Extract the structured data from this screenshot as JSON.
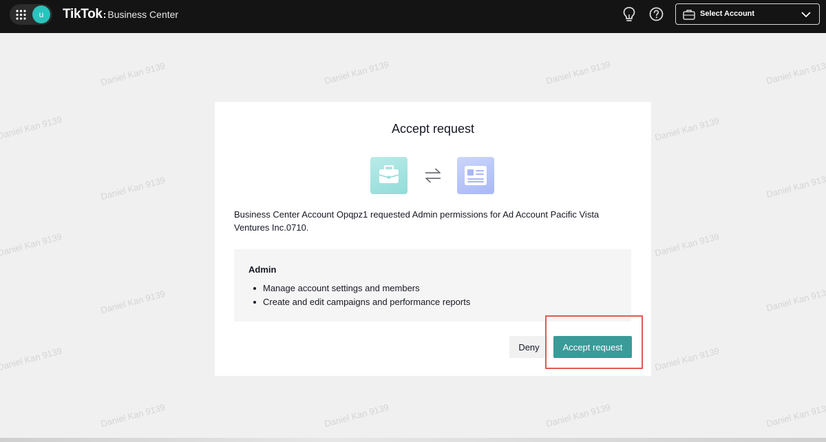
{
  "topbar": {
    "avatar_initial": "u",
    "brand_name": "TikTok",
    "brand_separator": ":",
    "brand_product": "Business Center",
    "account_selector_label": "Select Account",
    "icons": [
      "apps-grid-icon",
      "lightbulb-icon",
      "help-icon",
      "briefcase-icon",
      "chevron-down-icon"
    ]
  },
  "watermark_text": "Daniel Kan 9139",
  "modal": {
    "title": "Accept request",
    "icons": [
      "business-center-icon",
      "swap-arrows-icon",
      "ad-account-icon"
    ],
    "description": "Business Center Account Opqpz1 requested Admin permissions for Ad Account Pacific Vista Ventures Inc.0710.",
    "permission": {
      "title": "Admin",
      "items": [
        "Manage account settings and members",
        "Create and edit campaigns and performance reports"
      ]
    },
    "deny_label": "Deny",
    "accept_label": "Accept request"
  },
  "colors": {
    "topbar_bg": "#141414",
    "accent": "#3a9b99",
    "avatar": "#2bc3bd",
    "highlight": "#e05a52"
  }
}
